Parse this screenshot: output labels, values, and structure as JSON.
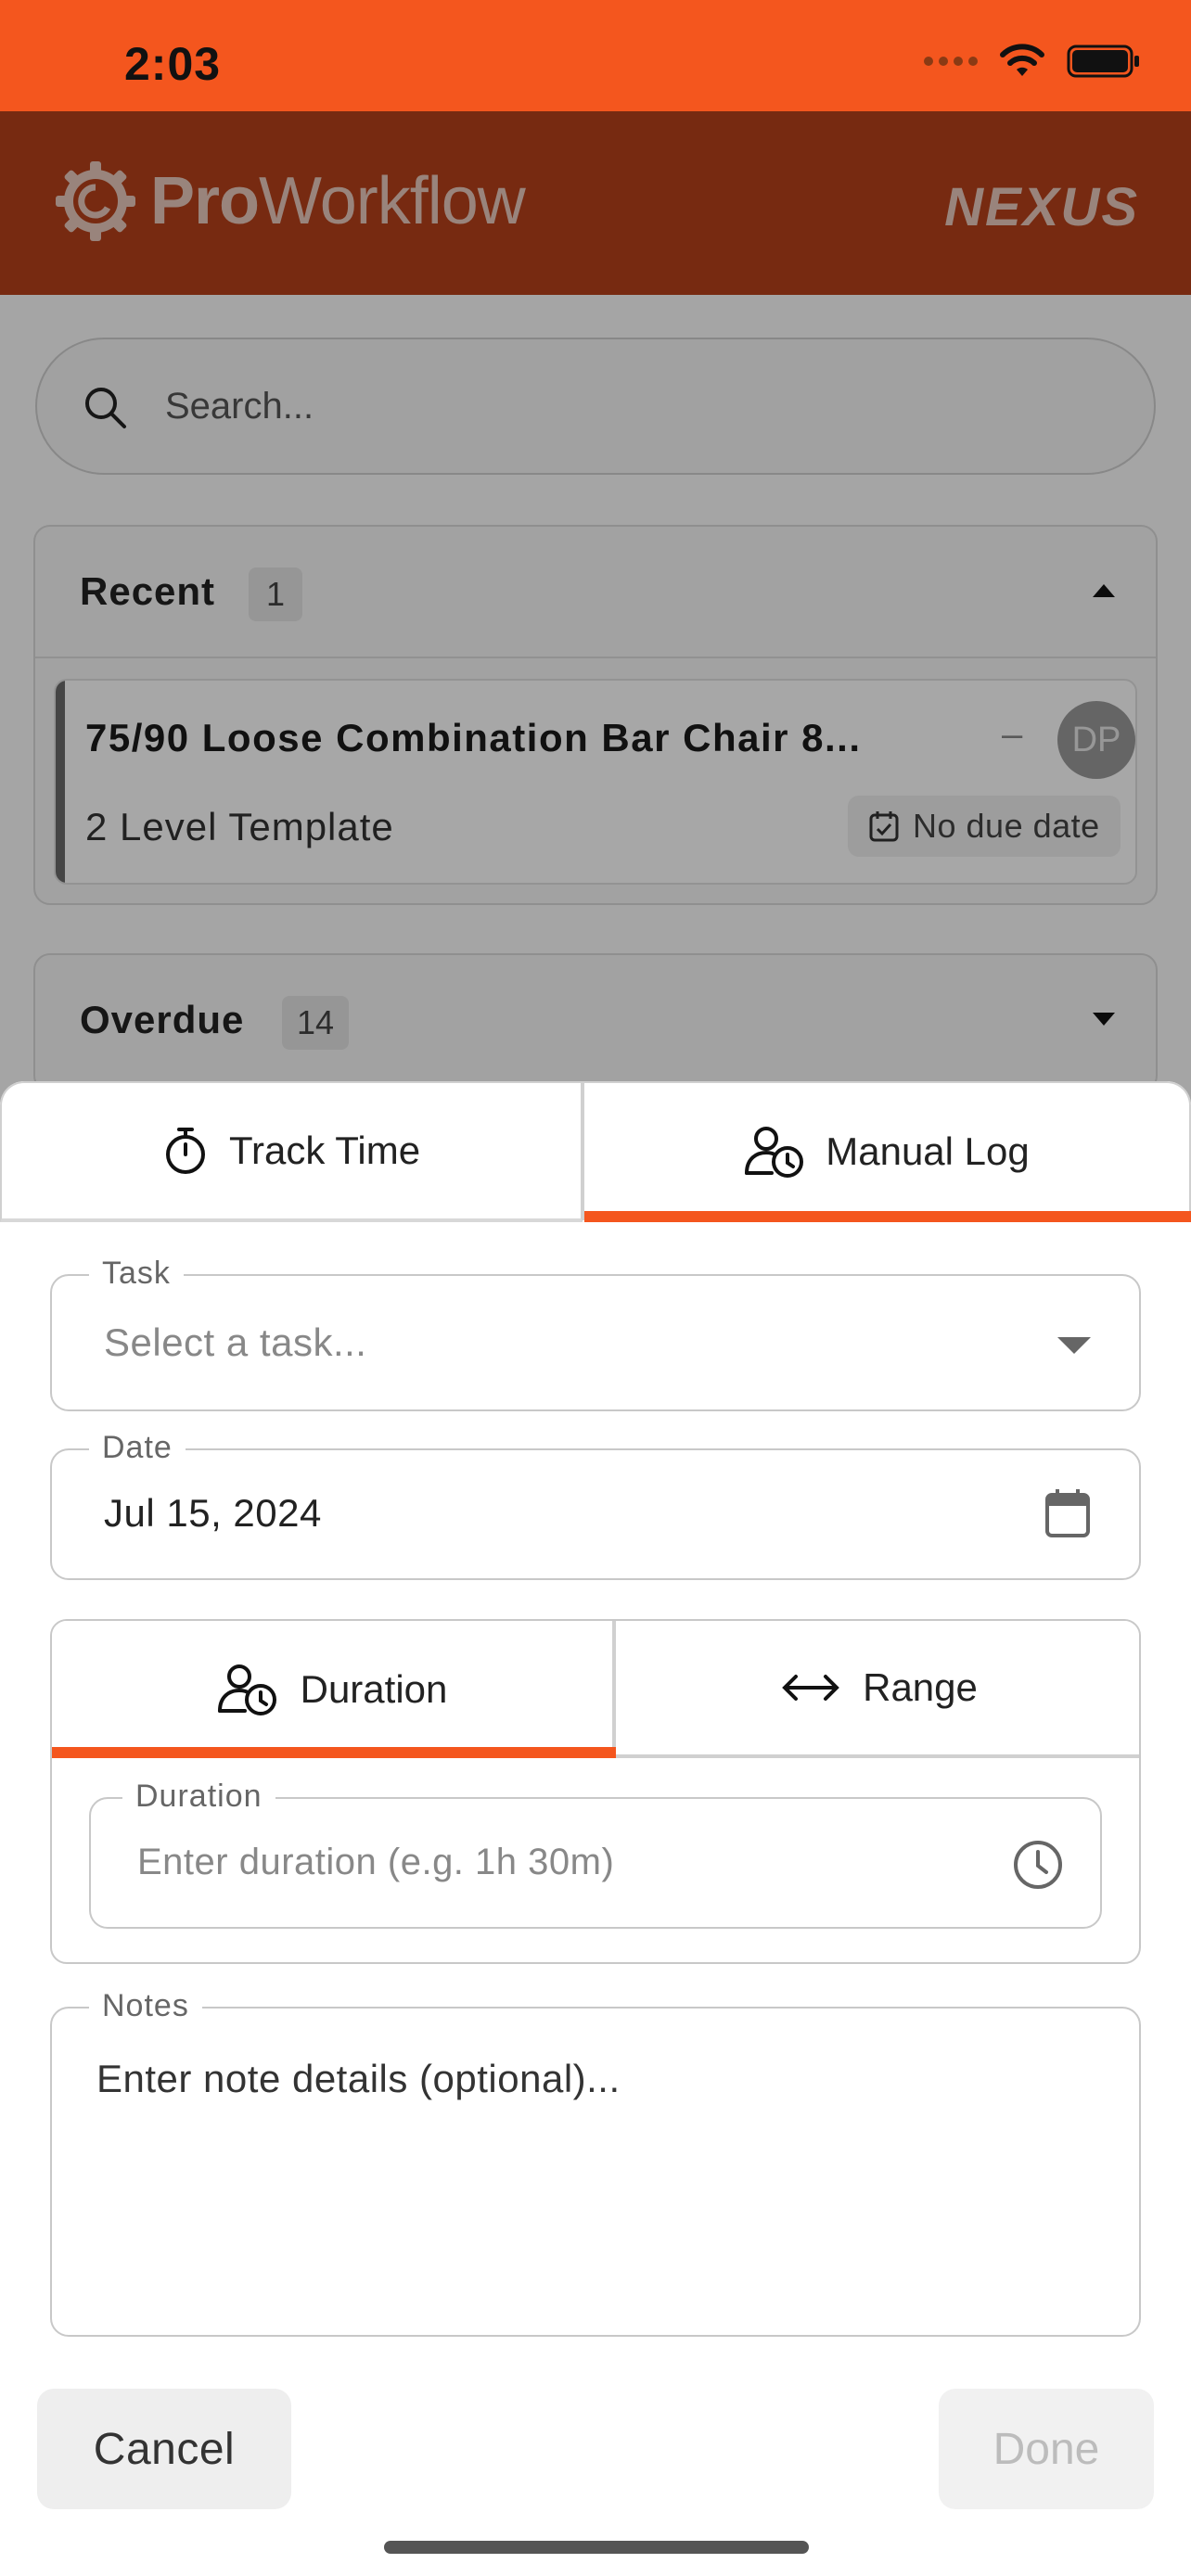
{
  "status_bar": {
    "time": "2:03"
  },
  "header": {
    "logo_bold": "Pro",
    "logo_light": "Workflow",
    "brand_right": "NEXUS"
  },
  "search": {
    "placeholder": "Search..."
  },
  "sections": {
    "recent": {
      "title": "Recent",
      "count": "1"
    },
    "overdue": {
      "title": "Overdue",
      "count": "14"
    }
  },
  "recent_task": {
    "title": "75/90 Loose Combination Bar Chair 8...",
    "separator": "–",
    "avatar_initials": "DP",
    "project": "2 Level Template",
    "due": "No due date"
  },
  "sheet": {
    "tabs": {
      "track_time": "Track Time",
      "manual_log": "Manual Log"
    },
    "active_tab": "Manual Log",
    "task_field": {
      "label": "Task",
      "placeholder": "Select a task..."
    },
    "date_field": {
      "label": "Date",
      "value": "Jul 15, 2024"
    },
    "mode_tabs": {
      "duration": "Duration",
      "range": "Range"
    },
    "active_mode": "Duration",
    "duration_field": {
      "label": "Duration",
      "placeholder": "Enter duration (e.g. 1h 30m)"
    },
    "notes_field": {
      "label": "Notes",
      "placeholder": "Enter note details (optional)..."
    },
    "cancel_label": "Cancel",
    "done_label": "Done"
  },
  "colors": {
    "accent": "#F4561E",
    "header_bg": "#B5401A"
  }
}
